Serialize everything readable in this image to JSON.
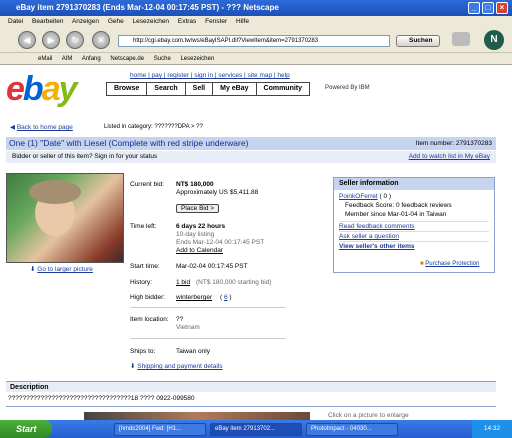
{
  "window": {
    "title": "eBay item 2791370283 (Ends Mar-12-04 00:17:45 PST) - ??? Netscape",
    "controls": [
      "_",
      "□",
      "×"
    ]
  },
  "menu": [
    "Datei",
    "Bearbeiten",
    "Anzeigen",
    "Gehe",
    "Lesezeichen",
    "Extras",
    "Fenster",
    "Hilfe"
  ],
  "nav": {
    "url": "http://cgi.ebay.com.tw/ws/eBayISAPI.dll?ViewItem&item=2791370283",
    "search_label": "Suchen"
  },
  "bookmarks": [
    "eMail",
    "AIM",
    "Anfang",
    "Netscape.de",
    "Suche",
    "Lesezeichen"
  ],
  "ebay": {
    "logo": "ebay",
    "links": "home | pay | register | sign in | services | site map | help",
    "tabs": [
      "Browse",
      "Search",
      "Sell",
      "My eBay",
      "Community"
    ],
    "powered": "Powered By IBM",
    "back": "Back to home page",
    "category": "Listed in category: ???????DPA > ??",
    "title": "One (1) \"Date\" with Liesel (Complete with red stripe underware)",
    "item_number": "Item number: 2791370283",
    "bidder_prompt": "Bidder or seller of this item? Sign in for your status",
    "watch": "Add to watch list in My eBay",
    "larger_picture": "Go to larger picture",
    "details": {
      "current_bid_label": "Current bid:",
      "current_bid": "NT$ 180,000",
      "approx": "Approximately US $5,411.88",
      "place_bid": "Place Bid >",
      "time_left_label": "Time left:",
      "time_left": "6 days 22 hours",
      "listing": "10-day listing",
      "ends": "Ends Mar-12-04 00:17:45 PST",
      "calendar": "Add to Calendar",
      "start_label": "Start time:",
      "start": "Mar-02-04 00:17:45 PST",
      "history_label": "History:",
      "history": "1 bid",
      "history_note": "(NT$ 180,000 starting bid)",
      "high_label": "High bidder:",
      "high_bidder": "winterberger",
      "high_score": "6",
      "location_label": "Item location:",
      "location": "??",
      "country": "Vietnam",
      "ships_label": "Ships to:",
      "ships": "Taiwan only",
      "shipping_link": "Shipping and payment details"
    },
    "seller": {
      "header": "Seller information",
      "name": "PoinkOFerret",
      "score": "0",
      "feedback": "Feedback Score: 0 feedback reviews",
      "since": "Member since Mar-01-04 in Taiwan",
      "read_feedback": "Read feedback comments",
      "ask": "Ask seller a question",
      "other": "View seller's other items",
      "protection": "Purchase Protection"
    },
    "description_header": "Description",
    "description": "??????????????????????????????????18 ???? 0922-099580",
    "enlarge": "Click on a picture to enlarge"
  },
  "taskbar": {
    "start": "Start",
    "tasks": [
      "[hmdc2004] Fwd: [H1...",
      "eBay item 27913702...",
      "PhotoImpact - 04030..."
    ],
    "clock": "14:32"
  }
}
